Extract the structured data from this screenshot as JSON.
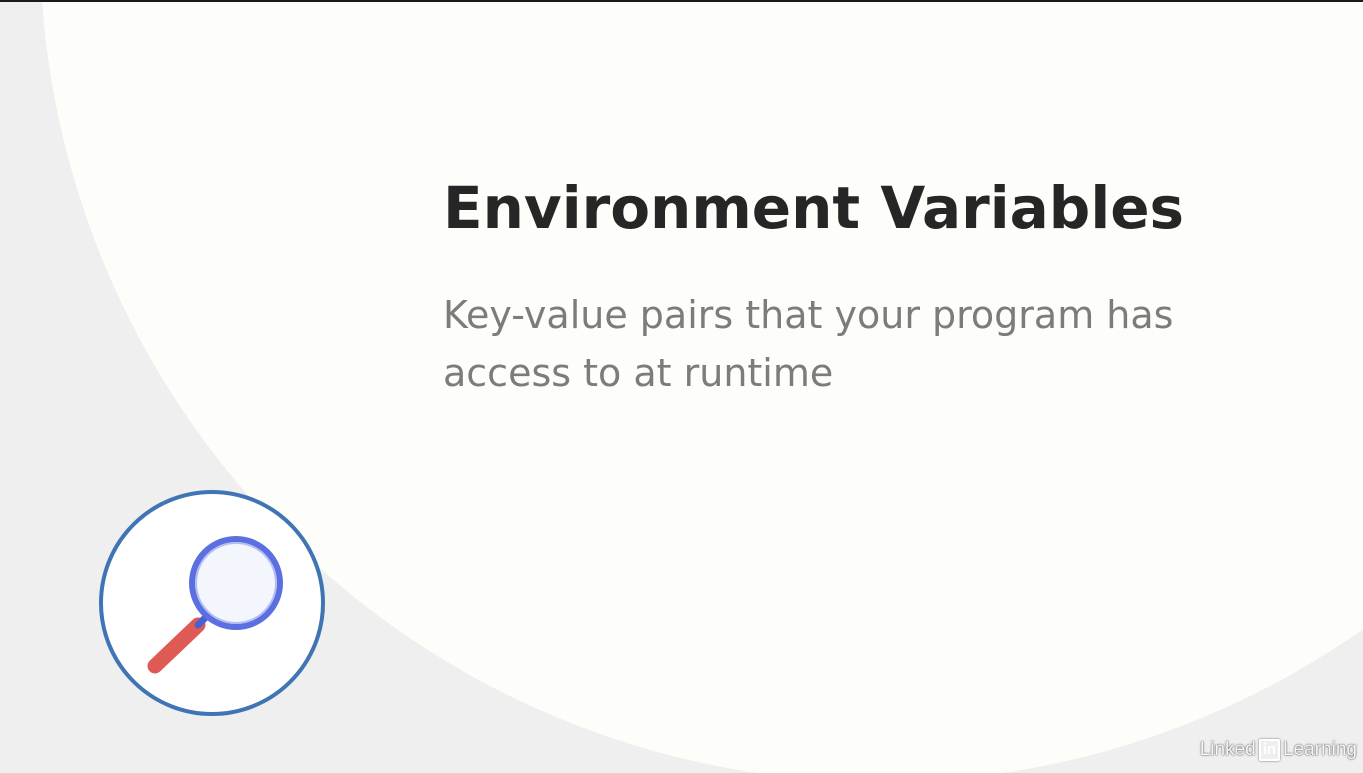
{
  "slide": {
    "title": "Environment Variables",
    "subtitle": "Key-value pairs that your program has access to at runtime"
  },
  "icon": {
    "name": "magnifying-glass-icon",
    "ring_color": "#3f74b5",
    "lens_color": "#5b6fe0",
    "handle_color": "#e05a55"
  },
  "watermark": {
    "left_text": "Linked",
    "badge_text": "in",
    "right_text": "Learning"
  },
  "colors": {
    "background": "#efefef",
    "panel": "#fdfdf9",
    "title": "#262626",
    "subtitle": "#7c7c7c"
  }
}
